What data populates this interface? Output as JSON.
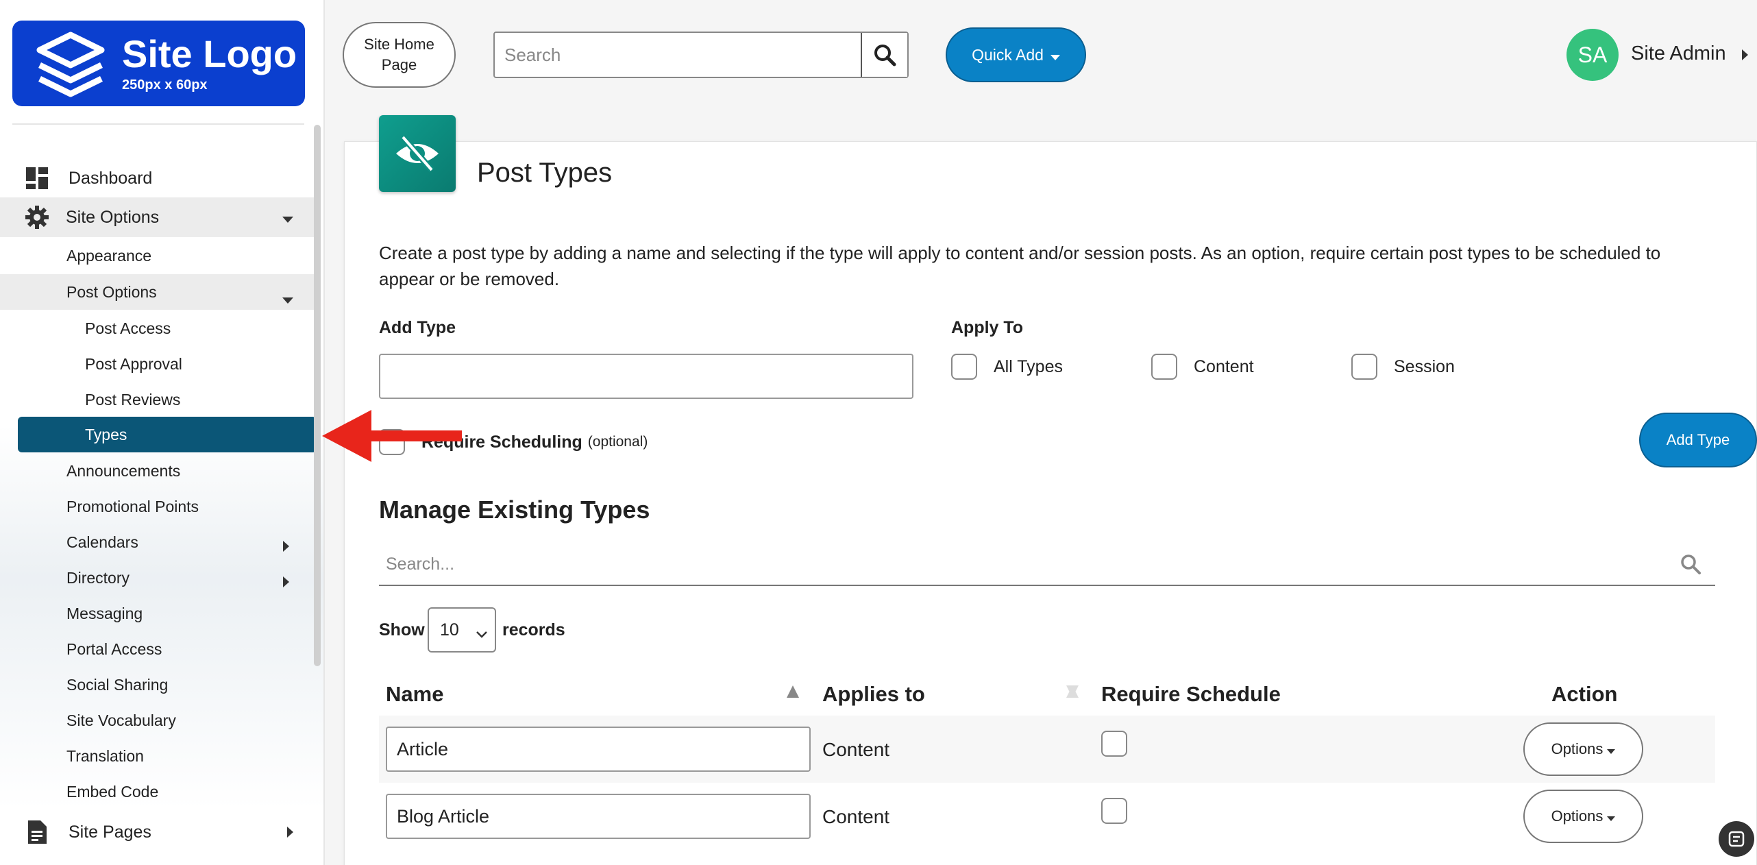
{
  "logo": {
    "title": "Site Logo",
    "subtitle": "250px x 60px",
    "color": "#0b3fcf"
  },
  "sidebar": {
    "items": [
      {
        "label": "Dashboard",
        "icon": "dashboard-icon"
      },
      {
        "label": "Site Options",
        "icon": "gear-icon",
        "expanded": true
      },
      {
        "label": "Site Pages",
        "icon": "document-icon"
      }
    ],
    "site_options_children": [
      "Appearance",
      "Post Options",
      "Announcements",
      "Promotional Points",
      "Calendars",
      "Directory",
      "Messaging",
      "Portal Access",
      "Social Sharing",
      "Site Vocabulary",
      "Translation",
      "Embed Code"
    ],
    "post_options_children": [
      "Post Access",
      "Post Approval",
      "Post Reviews",
      "Types"
    ],
    "active_item": "Types",
    "active_color": "#0b5677"
  },
  "header": {
    "home_button": "Site Home Page",
    "search_placeholder": "Search",
    "quick_add": "Quick Add",
    "avatar_initials": "SA",
    "user_name": "Site Admin"
  },
  "page": {
    "title": "Post Types",
    "icon": "eye-slash-icon",
    "description": "Create a post type by adding a name and selecting if the type will apply to content and/or session posts. As an option, require certain post types to be scheduled to appear or be removed.",
    "add_type_label": "Add Type",
    "add_type_value": "",
    "apply_to_label": "Apply To",
    "apply_options": [
      "All Types",
      "Content",
      "Session"
    ],
    "require_scheduling_label": "Require Scheduling",
    "optional_label": "(optional)",
    "add_type_button": "Add Type",
    "manage_title": "Manage Existing Types",
    "filter_placeholder": "Search...",
    "show_label": "Show",
    "records_value": "10",
    "records_label": "records"
  },
  "table": {
    "columns": [
      "Name",
      "Applies to",
      "Require Schedule",
      "Action"
    ],
    "rows": [
      {
        "name": "Article",
        "applies_to": "Content",
        "require_schedule": false,
        "action": "Options"
      },
      {
        "name": "Blog Article",
        "applies_to": "Content",
        "require_schedule": false,
        "action": "Options"
      }
    ]
  },
  "colors": {
    "primary_button": "#0a82c6",
    "page_icon": "#0f9e8e",
    "avatar": "#35c27d",
    "annotation_arrow": "#e8251b"
  }
}
